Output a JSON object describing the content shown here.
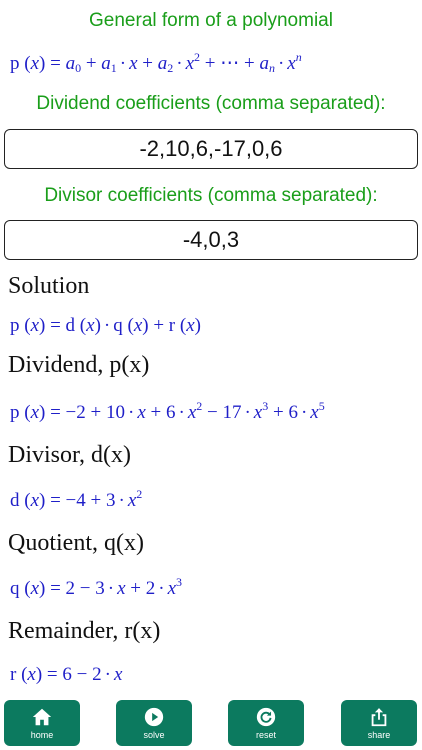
{
  "general_form_title": "General form of a polynomial",
  "dividend_label": "Dividend coefficients (comma separated):",
  "dividend_value": "-2,10,6,-17,0,6",
  "divisor_label": "Divisor coefficients (comma separated):",
  "divisor_value": "-4,0,3",
  "sections": {
    "solution": "Solution",
    "dividend": "Dividend, p(x)",
    "divisor": "Divisor, d(x)",
    "quotient": "Quotient, q(x)",
    "remainder": "Remainder, r(x)"
  },
  "toolbar": {
    "home": "home",
    "solve": "solve",
    "reset": "reset",
    "share": "share"
  },
  "colors": {
    "label_green": "#1a9e1a",
    "math_blue": "#1f1fc8",
    "toolbar_green": "#0c7a5f"
  },
  "icons": [
    "home-icon",
    "play-icon",
    "reset-icon",
    "share-icon"
  ]
}
